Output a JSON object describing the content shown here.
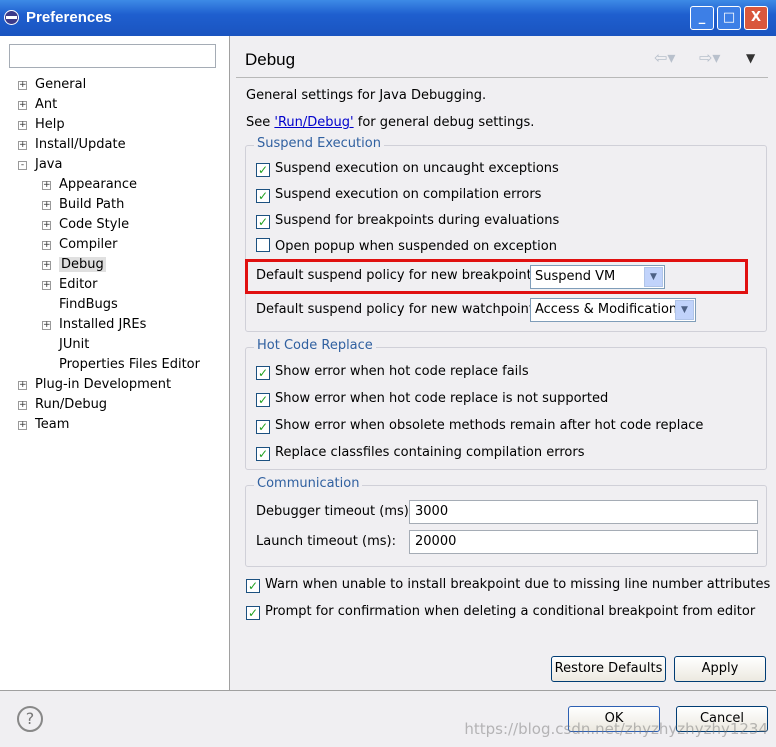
{
  "window": {
    "title": "Preferences",
    "minimize": "_",
    "maximize": "□",
    "close": "X"
  },
  "filter": {
    "value": ""
  },
  "tree": [
    {
      "label": "General",
      "level": 0,
      "expander": "+"
    },
    {
      "label": "Ant",
      "level": 0,
      "expander": "+"
    },
    {
      "label": "Help",
      "level": 0,
      "expander": "+"
    },
    {
      "label": "Install/Update",
      "level": 0,
      "expander": "+"
    },
    {
      "label": "Java",
      "level": 0,
      "expander": "-"
    },
    {
      "label": "Appearance",
      "level": 1,
      "expander": "+"
    },
    {
      "label": "Build Path",
      "level": 1,
      "expander": "+"
    },
    {
      "label": "Code Style",
      "level": 1,
      "expander": "+"
    },
    {
      "label": "Compiler",
      "level": 1,
      "expander": "+"
    },
    {
      "label": "Debug",
      "level": 1,
      "expander": "+",
      "selected": true
    },
    {
      "label": "Editor",
      "level": 1,
      "expander": "+"
    },
    {
      "label": "FindBugs",
      "level": 1,
      "expander": ""
    },
    {
      "label": "Installed JREs",
      "level": 1,
      "expander": "+"
    },
    {
      "label": "JUnit",
      "level": 1,
      "expander": ""
    },
    {
      "label": "Properties Files Editor",
      "level": 1,
      "expander": ""
    },
    {
      "label": "Plug-in Development",
      "level": 0,
      "expander": "+"
    },
    {
      "label": "Run/Debug",
      "level": 0,
      "expander": "+"
    },
    {
      "label": "Team",
      "level": 0,
      "expander": "+"
    }
  ],
  "page": {
    "title": "Debug",
    "description": "General settings for Java Debugging.",
    "see_prefix": "See ",
    "see_link": "'Run/Debug'",
    "see_suffix": " for general debug settings.",
    "suspend_group": {
      "label": "Suspend Execution",
      "options": [
        {
          "label": "Suspend execution on uncaught exceptions",
          "checked": true
        },
        {
          "label": "Suspend execution on compilation errors",
          "checked": true
        },
        {
          "label": "Suspend for breakpoints during evaluations",
          "checked": true
        },
        {
          "label": "Open popup when suspended on exception",
          "checked": false
        }
      ],
      "breakpoint_policy_label": "Default suspend policy for new breakpoints:",
      "breakpoint_policy": "Suspend VM",
      "watchpoint_policy_label": "Default suspend policy for new watchpoints:",
      "watchpoint_policy": "Access & Modification"
    },
    "hcr_group": {
      "label": "Hot Code Replace",
      "options": [
        {
          "label": "Show error when hot code replace fails",
          "checked": true
        },
        {
          "label": "Show error when hot code replace is not supported",
          "checked": true
        },
        {
          "label": "Show error when obsolete methods remain after hot code replace",
          "checked": true
        },
        {
          "label": "Replace classfiles containing compilation errors",
          "checked": true
        }
      ]
    },
    "comm_group": {
      "label": "Communication",
      "debugger_timeout_label": "Debugger timeout (ms):",
      "debugger_timeout": "3000",
      "launch_timeout_label": "Launch timeout (ms):",
      "launch_timeout": "20000"
    },
    "extra": [
      {
        "label": "Warn when unable to install breakpoint due to missing line number attributes",
        "checked": true
      },
      {
        "label": "Prompt for confirmation when deleting a conditional breakpoint from editor",
        "checked": true
      }
    ],
    "restore_defaults": "Restore Defaults",
    "apply": "Apply"
  },
  "footer": {
    "help": "?",
    "ok": "OK",
    "cancel": "Cancel"
  },
  "watermark": "https://blog.csdn.net/zhyzhyzhyzhy1234",
  "colors": {
    "highlight": "#e01010",
    "titlebar": "#1f5fcf"
  }
}
